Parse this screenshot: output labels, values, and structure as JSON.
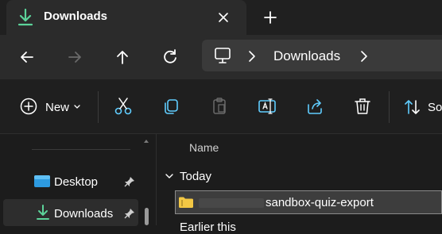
{
  "tab": {
    "title": "Downloads",
    "close_icon": "close-icon",
    "new_tab_icon": "plus-icon"
  },
  "nav": {
    "back_icon": "arrow-left-icon",
    "forward_icon": "arrow-right-icon",
    "up_icon": "arrow-up-icon",
    "refresh_icon": "refresh-icon"
  },
  "address": {
    "root_icon": "monitor-icon",
    "segment": "Downloads"
  },
  "commands": {
    "new_label": "New",
    "sort_label": "So"
  },
  "sidebar": {
    "items": [
      {
        "label": "Desktop",
        "icon": "desktop-folder-icon",
        "pinned": true
      },
      {
        "label": "Downloads",
        "icon": "download-icon",
        "pinned": true,
        "selected": true
      }
    ]
  },
  "main": {
    "column_name": "Name",
    "groups": [
      {
        "label": "Today",
        "files": [
          {
            "name": "sandbox-quiz-export",
            "selected": true
          }
        ]
      },
      {
        "label": "Earlier this"
      }
    ]
  },
  "colors": {
    "accent_green": "#5cd39a",
    "accent_blue": "#60cdff",
    "folder_yellow": "#f2c744"
  }
}
